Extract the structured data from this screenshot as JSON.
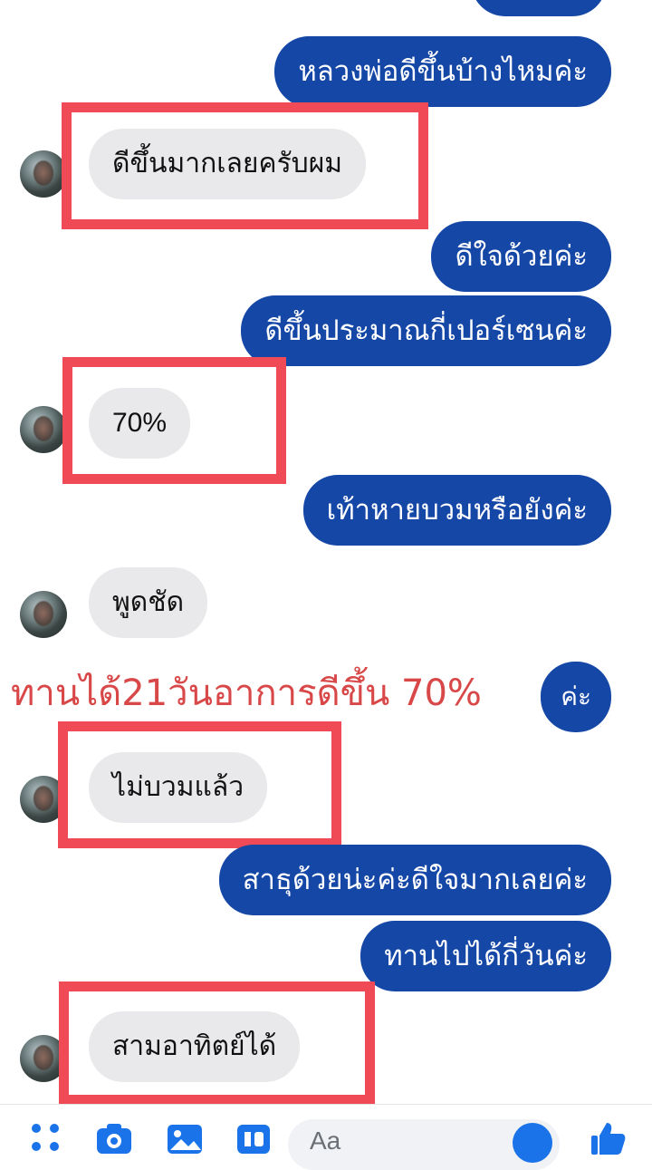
{
  "messages": [
    {
      "id": "m1",
      "side": "out",
      "text": "หลวงพ่อดีขึ้นบ้างไหมค่ะ"
    },
    {
      "id": "m2",
      "side": "in",
      "text": "ดีขึ้นมากเลยครับผม"
    },
    {
      "id": "m3",
      "side": "out",
      "text": "ดีใจด้วยค่ะ"
    },
    {
      "id": "m4",
      "side": "out",
      "text": "ดีขึ้นประมาณกี่เปอร์เซนค่ะ"
    },
    {
      "id": "m5",
      "side": "in",
      "text": "70%"
    },
    {
      "id": "m6",
      "side": "out",
      "text": "เท้าหายบวมหรือยังค่ะ"
    },
    {
      "id": "m7",
      "side": "in",
      "text": "พูดชัด"
    },
    {
      "id": "m8",
      "side": "out",
      "text": "ค่ะ"
    },
    {
      "id": "m9",
      "side": "in",
      "text": "ไม่บวมแล้ว"
    },
    {
      "id": "m10",
      "side": "out",
      "text": "สาธุด้วยน่ะค่ะดีใจมากเลยค่ะ"
    },
    {
      "id": "m11",
      "side": "out",
      "text": "ทานไปได้กี่วันค่ะ"
    },
    {
      "id": "m12",
      "side": "in",
      "text": "สามอาทิตย์ได้"
    }
  ],
  "overlay_caption": "ทานได้21วันอาการดีขึ้น 70%",
  "composer": {
    "placeholder": "Aa"
  },
  "toolbar_icons": [
    "apps-icon",
    "camera-icon",
    "image-icon",
    "gif-icon",
    "emoji-icon",
    "like-icon"
  ],
  "colors": {
    "outgoing_bubble": "#1547a6",
    "incoming_bubble": "#e9e9eb",
    "highlight_border": "#ef4a55",
    "overlay_text": "#d94848"
  }
}
